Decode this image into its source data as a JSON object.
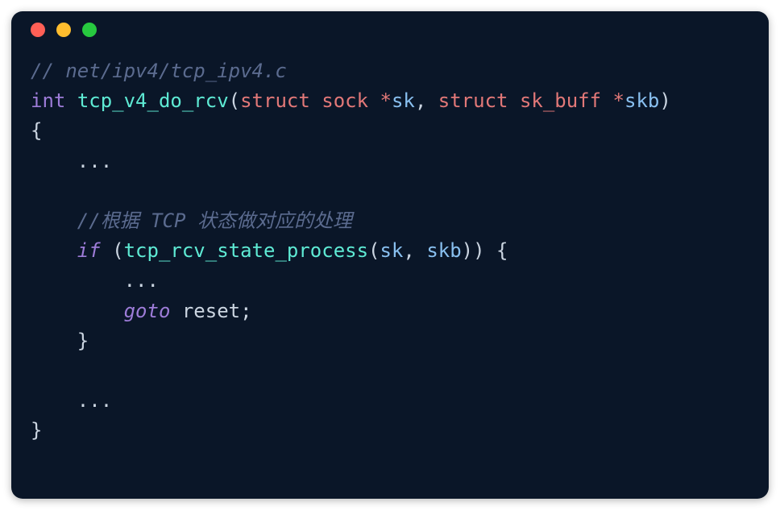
{
  "code": {
    "line1_comment": "// net/ipv4/tcp_ipv4.c",
    "line2_type_int": "int",
    "line2_func": "tcp_v4_do_rcv",
    "line2_struct1": "struct",
    "line2_type_sock": "sock",
    "line2_star1": "*",
    "line2_param_sk": "sk",
    "line2_comma": ", ",
    "line2_struct2": "struct",
    "line2_type_skbuff": "sk_buff",
    "line2_star2": "*",
    "line2_param_skb": "skb",
    "line2_paren_close": ")",
    "line3_brace": "{",
    "line4_ellipsis": "    ...",
    "line5_blank": "",
    "line6_comment": "    //根据 TCP 状态做对应的处理",
    "line7_if": "if",
    "line7_paren_open": " (",
    "line7_func": "tcp_rcv_state_process",
    "line7_paren2": "(sk, skb)) {",
    "line7_sk": "sk",
    "line7_comma": ", ",
    "line7_skb": "skb",
    "line7_close": ")) {",
    "line8_ellipsis": "        ...",
    "line9_goto": "goto",
    "line9_reset": " reset",
    "line9_semi": ";",
    "line10_brace": "    }",
    "line11_blank": "",
    "line12_ellipsis": "    ...",
    "line13_brace": "}"
  }
}
